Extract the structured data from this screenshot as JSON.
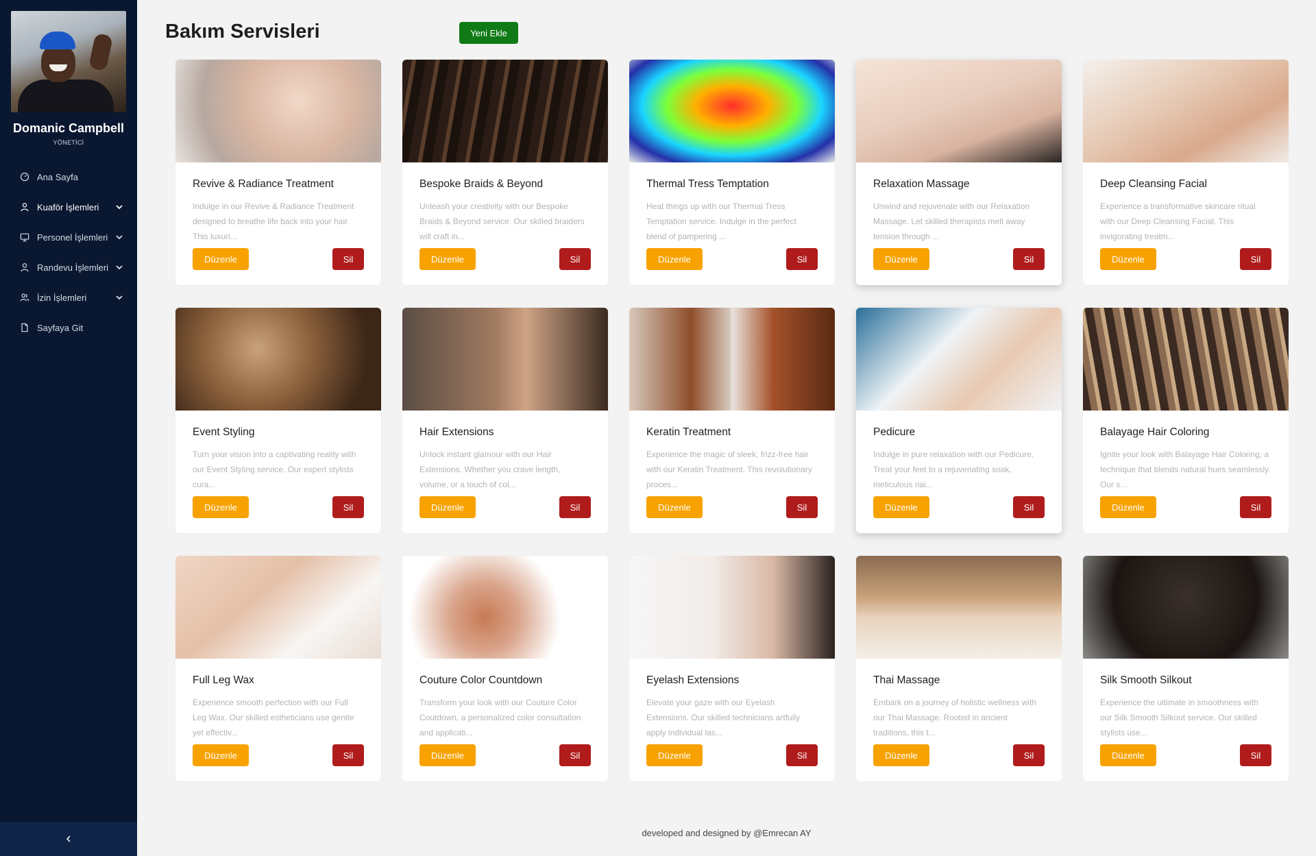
{
  "user": {
    "name": "Domanic Campbell",
    "role": "YÖNETİCİ"
  },
  "nav": {
    "items": [
      {
        "label": "Ana Sayfa",
        "icon": "gauge-icon",
        "has_children": false
      },
      {
        "label": "Kuaför İşlemleri",
        "icon": "user-icon",
        "has_children": true
      },
      {
        "label": "Personel İşlemleri",
        "icon": "monitor-icon",
        "has_children": true
      },
      {
        "label": "Randevu İşlemleri",
        "icon": "user-icon",
        "has_children": true
      },
      {
        "label": "İzin İşlemleri",
        "icon": "user-group-icon",
        "has_children": true
      },
      {
        "label": "Sayfaya Git",
        "icon": "file-icon",
        "has_children": false
      }
    ]
  },
  "header": {
    "title": "Bakım Servisleri",
    "new_button": "Yeni Ekle"
  },
  "buttons": {
    "edit": "Düzenle",
    "delete": "Sil"
  },
  "services": [
    {
      "title": "Revive & Radiance Treatment",
      "description": "Indulge in our Revive & Radiance Treatment designed to breathe life back into your hair. This luxuri...",
      "image": "face-mask-photo"
    },
    {
      "title": "Bespoke Braids & Beyond",
      "description": "Unleash your creativity with our Bespoke Braids & Beyond service. Our skilled braiders will craft in...",
      "image": "braids-photo"
    },
    {
      "title": "Thermal Tress Temptation",
      "description": "Heat things up with our Thermal Tress Temptation service. Indulge in the perfect blend of pampering ...",
      "image": "thermal-face-photo"
    },
    {
      "title": "Relaxation Massage",
      "description": "Unwind and rejuvenate with our Relaxation Massage. Let skilled therapists melt away tension through ...",
      "image": "back-massage-photo"
    },
    {
      "title": "Deep Cleansing Facial",
      "description": "Experience a transformative skincare ritual with our Deep Cleansing Facial. This invigorating treatm...",
      "image": "facial-photo"
    },
    {
      "title": "Event Styling",
      "description": "Turn your vision into a captivating reality with our Event Styling service. Our expert stylists cura...",
      "image": "updo-hair-photo"
    },
    {
      "title": "Hair Extensions",
      "description": "Unlock instant glamour with our Hair Extensions. Whether you crave length, volume, or a touch of col...",
      "image": "man-portrait-photo"
    },
    {
      "title": "Keratin Treatment",
      "description": "Experience the magic of sleek, frizz-free hair with our Keratin Treatment. This revolutionary proces...",
      "image": "keratin-before-after-photo"
    },
    {
      "title": "Pedicure",
      "description": "Indulge in pure relaxation with our Pedicure. Treat your feet to a rejuvenating soak, meticulous nai...",
      "image": "foot-exam-photo"
    },
    {
      "title": "Balayage Hair Coloring",
      "description": "Ignite your look with Balayage Hair Coloring, a technique that blends natural hues seamlessly. Our s...",
      "image": "balayage-hair-photo"
    },
    {
      "title": "Full Leg Wax",
      "description": "Experience smooth perfection with our Full Leg Wax. Our skilled estheticians use gentle yet effectiv...",
      "image": "wax-strip-photo"
    },
    {
      "title": "Couture Color Countdown",
      "description": "Transform your look with our Couture Color Coutdown, a personalized color consultation and applicati...",
      "image": "makeup-kit-photo"
    },
    {
      "title": "Eyelash Extensions",
      "description": "Elevate your gaze with our Eyelash Extensions. Our skilled technicians artfully apply individual las...",
      "image": "eyelash-photo"
    },
    {
      "title": "Thai Massage",
      "description": "Embark on a journey of holistic wellness with our Thai Massage. Rooted in ancient traditions, this t...",
      "image": "thai-massage-photo"
    },
    {
      "title": "Silk Smooth Silkout",
      "description": "Experience the ultimate in smoothness with our Silk Smooth Silkout service. Our skilled stylists use...",
      "image": "curly-hair-photo"
    }
  ],
  "footer": {
    "text": "developed and designed by @Emrecan AY"
  },
  "colors": {
    "sidebar": "#0a1730",
    "new_button": "#0f7a16",
    "edit_button": "#f7a200",
    "delete_button": "#b01c1c"
  }
}
